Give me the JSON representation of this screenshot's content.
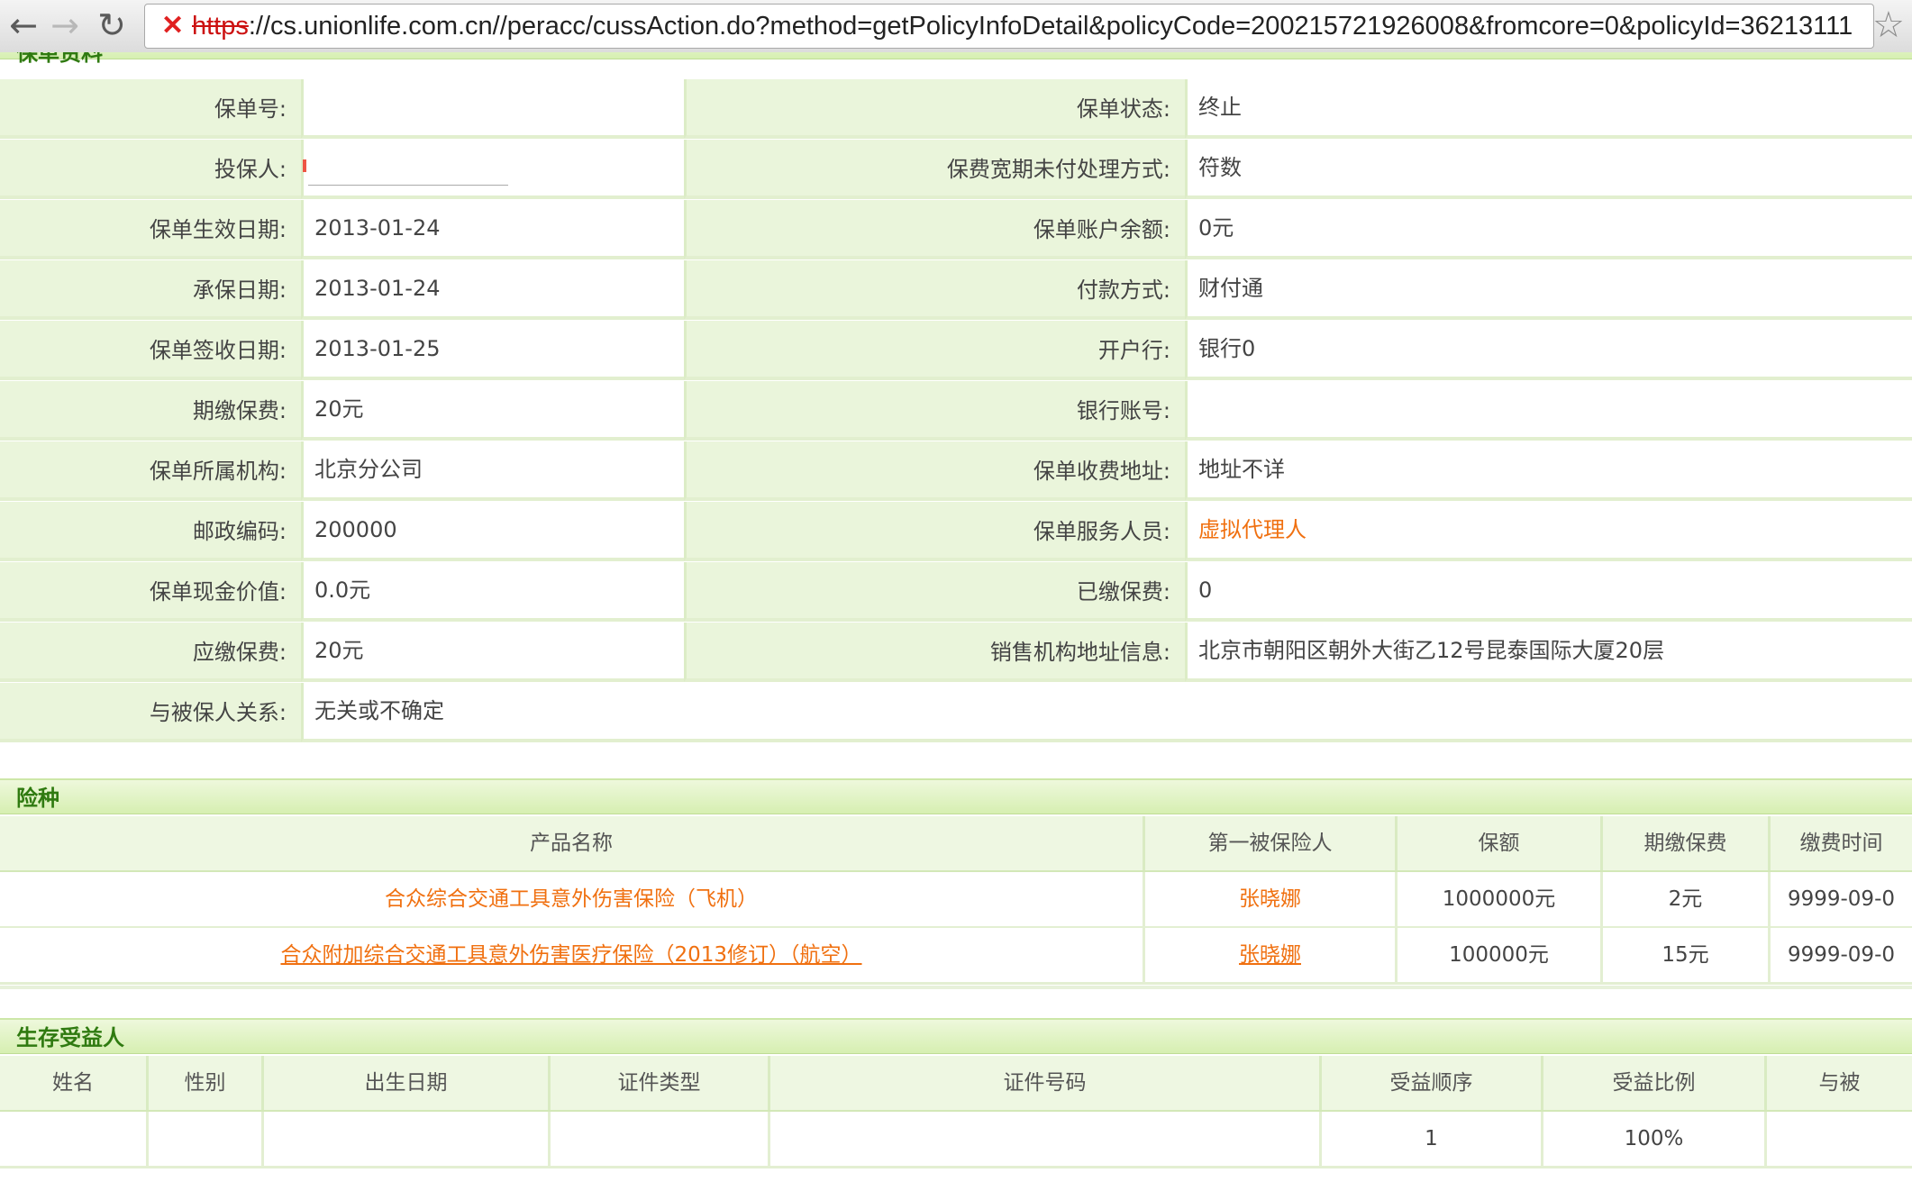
{
  "browser": {
    "back_icon": "arrow-left-icon",
    "forward_icon": "arrow-right-icon",
    "reload_icon": "reload-icon",
    "url_scheme": "https",
    "url_rest": "://cs.unionlife.com.cn//peracc/cussAction.do?method=getPolicyInfoDetail&policyCode=200215721926008&fromcore=0&policyId=36213111",
    "bookmark_icon": "star-icon"
  },
  "policy_section": {
    "title": "保单资料",
    "rows": [
      {
        "l1": "保单号:",
        "v1": "",
        "l2": "保单状态:",
        "v2": "终止"
      },
      {
        "l1": "投保人:",
        "v1": "",
        "l2": "保费宽期未付处理方式:",
        "v2": "符数"
      },
      {
        "l1": "保单生效日期:",
        "v1": "2013-01-24",
        "l2": "保单账户余额:",
        "v2": "0元"
      },
      {
        "l1": "承保日期:",
        "v1": "2013-01-24",
        "l2": "付款方式:",
        "v2": "财付通"
      },
      {
        "l1": "保单签收日期:",
        "v1": "2013-01-25",
        "l2": "开户行:",
        "v2": "银行0"
      },
      {
        "l1": "期缴保费:",
        "v1": "20元",
        "l2": "银行账号:",
        "v2": ""
      },
      {
        "l1": "保单所属机构:",
        "v1": "北京分公司",
        "l2": "保单收费地址:",
        "v2": "地址不详"
      },
      {
        "l1": "邮政编码:",
        "v1": "200000",
        "l2": "保单服务人员:",
        "v2": "虚拟代理人"
      },
      {
        "l1": "保单现金价值:",
        "v1": "0.0元",
        "l2": "已缴保费:",
        "v2": "0"
      },
      {
        "l1": "应缴保费:",
        "v1": "20元",
        "l2": "销售机构地址信息:",
        "v2": "北京市朝阳区朝外大街乙12号昆泰国际大厦20层"
      }
    ],
    "last_row": {
      "l1": "与被保人关系:",
      "v1": "无关或不确定"
    }
  },
  "coverage_section": {
    "title": "险种",
    "headers": [
      "产品名称",
      "第一被保险人",
      "保额",
      "期缴保费",
      "缴费时间"
    ],
    "rows": [
      [
        "合众综合交通工具意外伤害保险（飞机）",
        "张晓娜",
        "1000000元",
        "2元",
        "9999-09-0"
      ],
      [
        "合众附加综合交通工具意外伤害医疗保险（2013修订）（航空）",
        "张晓娜",
        "100000元",
        "15元",
        "9999-09-0"
      ]
    ]
  },
  "beneficiary_section": {
    "title": "生存受益人",
    "headers": [
      "姓名",
      "性别",
      "出生日期",
      "证件类型",
      "证件号码",
      "受益顺序",
      "受益比例",
      "与被"
    ],
    "rows": [
      [
        "",
        "",
        "",
        "",
        "",
        "1",
        "100%",
        ""
      ]
    ]
  }
}
